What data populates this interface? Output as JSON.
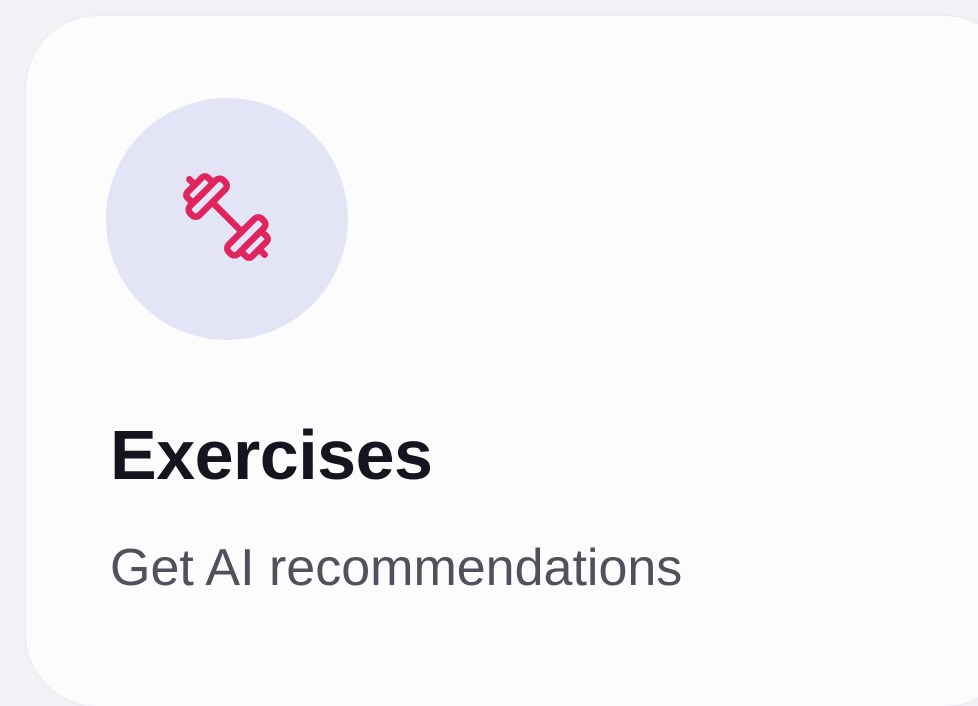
{
  "card": {
    "title": "Exercises",
    "subtitle": "Get AI recommendations",
    "icon": "dumbbell-icon",
    "colors": {
      "background": "#f1f1f6",
      "card": "#fcfcfd",
      "icon_circle": "#e3e5f7",
      "icon_stroke": "#e0245e",
      "title": "#15151f",
      "subtitle": "#50515a"
    }
  }
}
